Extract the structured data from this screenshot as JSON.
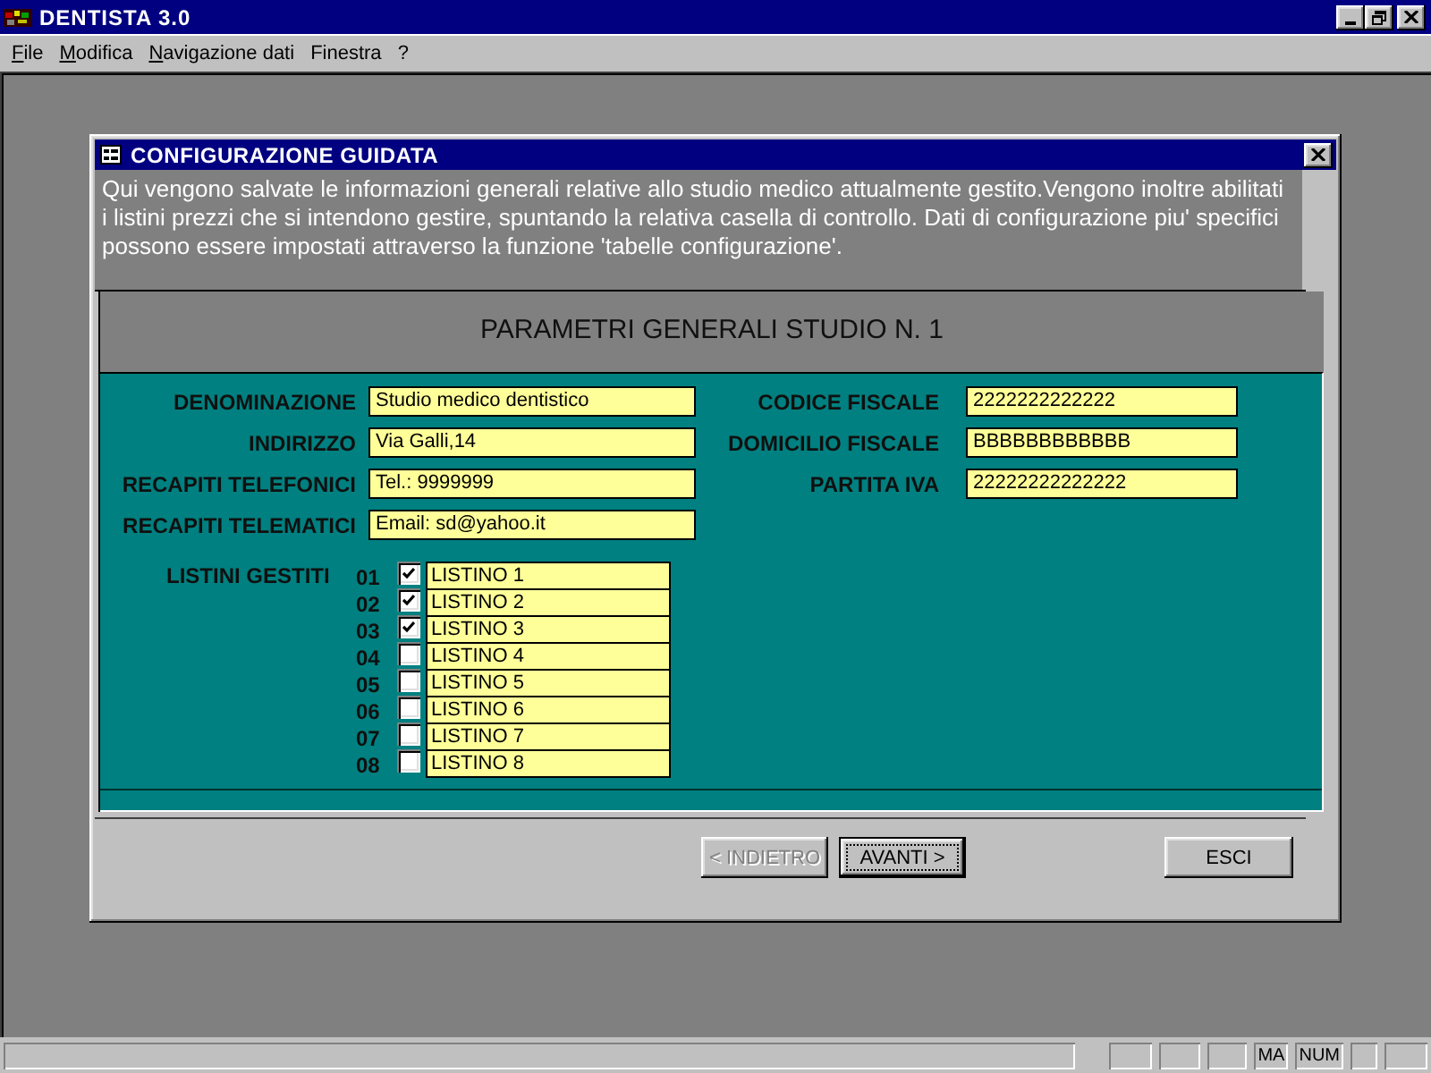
{
  "app_window": {
    "title": "DENTISTA 3.0"
  },
  "menu": [
    {
      "label": "File",
      "mnemonic": true
    },
    {
      "label": "Modifica",
      "mnemonic": true
    },
    {
      "label": "Navigazione dati",
      "mnemonic": true
    },
    {
      "label": "Finestra",
      "mnemonic": false
    },
    {
      "label": "?",
      "mnemonic": false
    }
  ],
  "dialog": {
    "title": "CONFIGURAZIONE GUIDATA",
    "description": "Qui vengono salvate le informazioni generali relative allo studio medico attualmente gestito.Vengono inoltre abilitati i listini prezzi che si intendono gestire, spuntando la relativa casella di controllo. Dati di configurazione piu' specifici possono essere impostati attraverso la funzione 'tabelle configurazione'.",
    "section_title": "PARAMETRI GENERALI STUDIO N. 1",
    "fields_left": [
      {
        "label": "DENOMINAZIONE",
        "value": "Studio medico dentistico"
      },
      {
        "label": "INDIRIZZO",
        "value": "Via Galli,14"
      },
      {
        "label": "RECAPITI TELEFONICI",
        "value": "Tel.: 9999999"
      },
      {
        "label": "RECAPITI TELEMATICI",
        "value": "Email: sd@yahoo.it"
      }
    ],
    "fields_right": [
      {
        "label": "CODICE FISCALE",
        "value": "2222222222222"
      },
      {
        "label": "DOMICILIO FISCALE",
        "value": "BBBBBBBBBBBB"
      },
      {
        "label": "PARTITA IVA",
        "value": "22222222222222"
      }
    ],
    "price_lists": {
      "label": "LISTINI GESTITI",
      "items": [
        {
          "number": "01",
          "checked": true,
          "value": "LISTINO 1"
        },
        {
          "number": "02",
          "checked": true,
          "value": "LISTINO 2"
        },
        {
          "number": "03",
          "checked": true,
          "value": "LISTINO 3"
        },
        {
          "number": "04",
          "checked": false,
          "value": "LISTINO 4"
        },
        {
          "number": "05",
          "checked": false,
          "value": "LISTINO 5"
        },
        {
          "number": "06",
          "checked": false,
          "value": "LISTINO 6"
        },
        {
          "number": "07",
          "checked": false,
          "value": "LISTINO 7"
        },
        {
          "number": "08",
          "checked": false,
          "value": "LISTINO 8"
        }
      ]
    },
    "buttons": [
      {
        "label": "< INDIETRO",
        "disabled": true,
        "default": false
      },
      {
        "label": "AVANTI >",
        "disabled": false,
        "default": true
      },
      {
        "label": "ESCI",
        "disabled": false,
        "default": false
      }
    ]
  },
  "status_bar": {
    "indicators": [
      "MA",
      "NUM"
    ]
  }
}
